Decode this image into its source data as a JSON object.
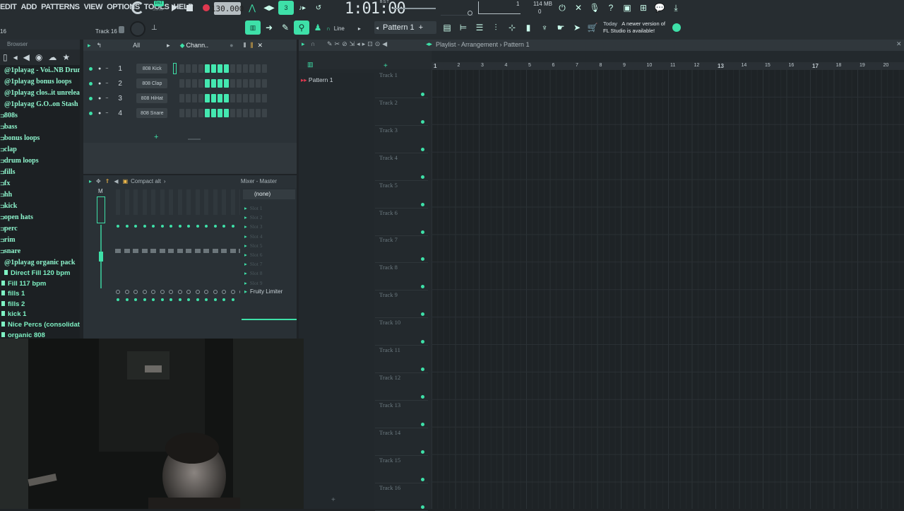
{
  "menu": [
    "EDIT",
    "ADD",
    "PATTERNS",
    "VIEW",
    "OPTIONS",
    "TOOLS",
    "HELP"
  ],
  "transport": {
    "pat_label": "PAT",
    "song_label": "SONG",
    "tempo": "130.000",
    "time": "1:01:00",
    "bst_label": "B:S:T",
    "memory": "114 MB",
    "cpu_value": "1",
    "poly_value": "0"
  },
  "toolbar2": {
    "left_number": "16",
    "track_hint": "Track 16",
    "snap_mode": "Line",
    "pattern_name": "Pattern 1",
    "news_date": "Today",
    "news_text_1": "A newer version of",
    "news_text_2": "FL Studio is available!"
  },
  "browser": {
    "title": "Browser",
    "folders": [
      "@1playag - Voi..NB Drum Kit)",
      "@1playag bonus loops",
      "@1playag clos..it unreleased",
      "@1playag G.O..on Stash Kit",
      "808s",
      "bass",
      "bonus loops",
      "clap",
      "drum loops",
      "fills",
      "fx",
      "hh",
      "kick",
      "open hats",
      "perc",
      "rim",
      "snare",
      "@1playag organic pack"
    ],
    "sub_items": [
      "Direct Fill 120 bpm",
      "Fill 117 bpm",
      "fills 1",
      "fills 2",
      "kick 1",
      "Nice Percs (consolidated)",
      "organic 808"
    ]
  },
  "channel_rack": {
    "filter": "All",
    "title": "Chann..",
    "channels": [
      {
        "num": "1",
        "name": "808 Kick"
      },
      {
        "num": "2",
        "name": "808 Clap"
      },
      {
        "num": "3",
        "name": "808 HiHat"
      },
      {
        "num": "4",
        "name": "808 Snare"
      }
    ],
    "active_steps": [
      4,
      5,
      6,
      7
    ]
  },
  "mixer": {
    "view": "Compact alt",
    "title": "Mixer - Master",
    "input": "(none)",
    "slots": [
      "Slot 1",
      "Slot 2",
      "Slot 3",
      "Slot 4",
      "Slot 5",
      "Slot 6",
      "Slot 7",
      "Slot 8",
      "Slot 9"
    ],
    "plugin": "Fruity Limiter",
    "master_label": "M"
  },
  "playlist": {
    "title": "Playlist - Arrangement",
    "pattern": "Pattern 1",
    "picker_item": "Pattern 1",
    "ruler_marks": [
      "1",
      "2",
      "3",
      "4",
      "5",
      "6",
      "7",
      "8",
      "9",
      "10",
      "11",
      "12",
      "13",
      "14",
      "15",
      "16",
      "17",
      "18",
      "19",
      "20"
    ],
    "tracks": [
      "Track 1",
      "Track 2",
      "Track 3",
      "Track 4",
      "Track 5",
      "Track 6",
      "Track 7",
      "Track 8",
      "Track 9",
      "Track 10",
      "Track 11",
      "Track 12",
      "Track 13",
      "Track 14",
      "Track 15",
      "Track 16"
    ]
  },
  "colors": {
    "accent": "#3ee0a8",
    "background": "#1f2326"
  }
}
